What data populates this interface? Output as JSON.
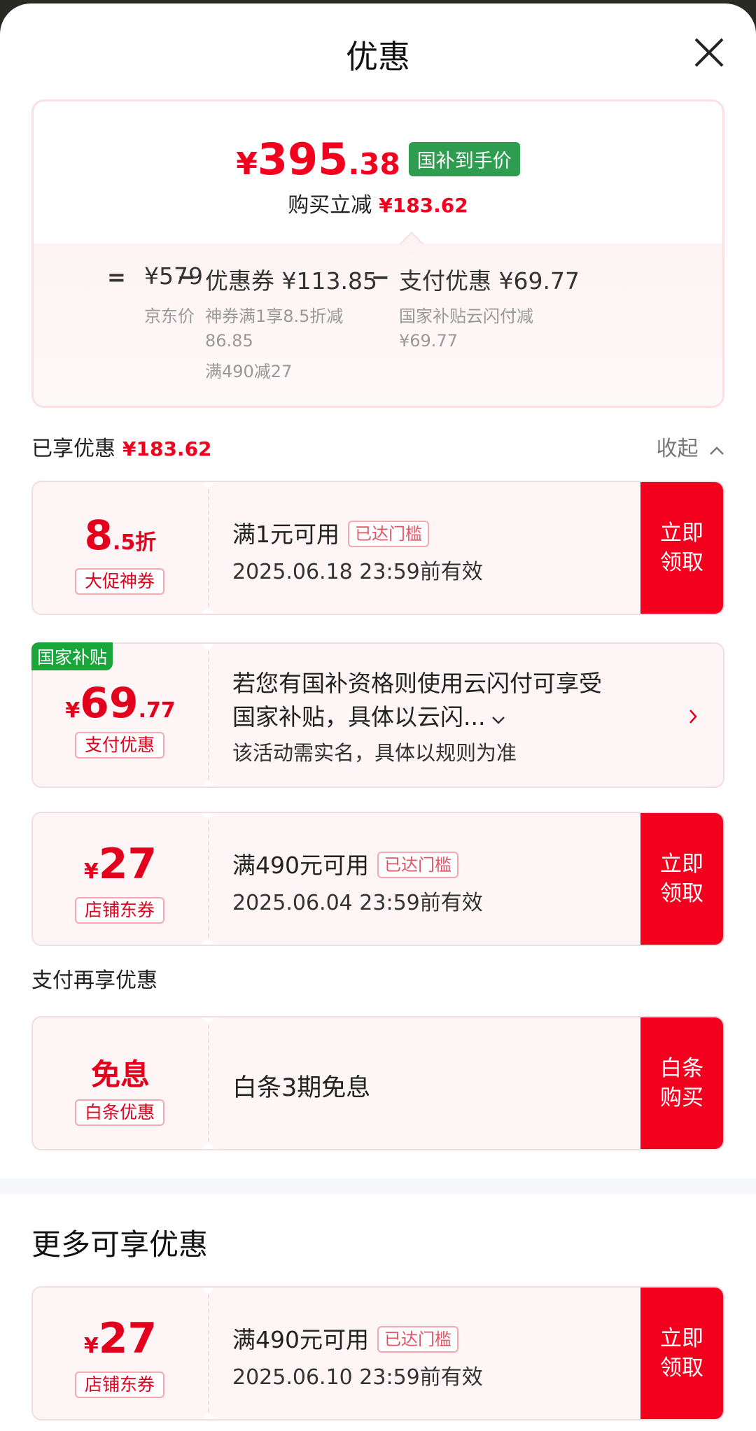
{
  "header": {
    "title": "优惠"
  },
  "summary": {
    "currency": "¥",
    "price_int": "395",
    "price_dec": ".38",
    "badge": "国补到手价",
    "reduce_label": "购买立减",
    "reduce_value": "¥183.62",
    "eq": "=",
    "minus": "−",
    "items": [
      {
        "value": "¥579",
        "sub1": "京东价"
      },
      {
        "value": "优惠券 ¥113.85",
        "sub1": "神券满1享8.5折减",
        "sub2": "86.85",
        "sub3": "满490减27"
      },
      {
        "value": "支付优惠 ¥69.77",
        "sub1": "国家补贴云闪付减",
        "sub2": "¥69.77"
      }
    ]
  },
  "enjoyed": {
    "label": "已享优惠",
    "value": "¥183.62",
    "fold": "收起"
  },
  "coupons": [
    {
      "amount_main": "8",
      "amount_suffix": ".5折",
      "tag": "大促神券",
      "title": "满1元可用",
      "pill": "已达门槛",
      "date": "2025.06.18 23:59前有效",
      "btn1": "立即",
      "btn2": "领取"
    },
    {
      "flag": "国家补贴",
      "currency": "¥",
      "amount_main": "69",
      "amount_suffix": ".77",
      "tag": "支付优惠",
      "line1": "若您有国补资格则使用云闪付可享受",
      "line2": "国家补贴，具体以云闪...",
      "line3": "该活动需实名，具体以规则为准"
    },
    {
      "currency": "¥",
      "amount_main": "27",
      "tag": "店铺东券",
      "title": "满490元可用",
      "pill": "已达门槛",
      "date": "2025.06.04 23:59前有效",
      "btn1": "立即",
      "btn2": "领取"
    }
  ],
  "pay_section": {
    "label": "支付再享优惠"
  },
  "baitiao": {
    "amount": "免息",
    "tag": "白条优惠",
    "title": "白条3期免息",
    "btn1": "白条",
    "btn2": "购买"
  },
  "more": {
    "title": "更多可享优惠"
  },
  "more_coupon": {
    "currency": "¥",
    "amount_main": "27",
    "tag": "店铺东券",
    "title": "满490元可用",
    "pill": "已达门槛",
    "date": "2025.06.10 23:59前有效",
    "btn1": "立即",
    "btn2": "领取"
  }
}
